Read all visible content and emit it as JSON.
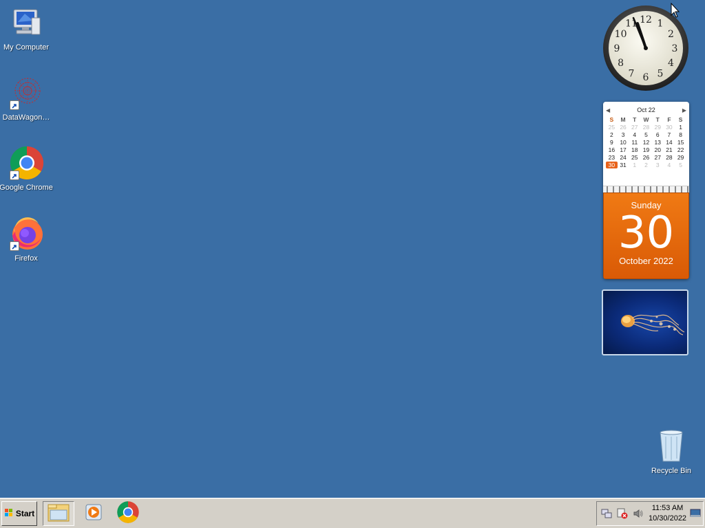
{
  "desktop": {
    "background": "#3a6ea5",
    "icons": [
      {
        "label": "My Computer",
        "icon": "computer-icon"
      },
      {
        "label": "DataWagon…",
        "icon": "datawagon-icon"
      },
      {
        "label": "Google Chrome",
        "icon": "chrome-icon"
      },
      {
        "label": "Firefox",
        "icon": "firefox-icon"
      }
    ],
    "recycle_bin": {
      "label": "Recycle Bin",
      "icon": "recycle-bin-icon"
    }
  },
  "clock_gadget": {
    "numerals": [
      "12",
      "1",
      "2",
      "3",
      "4",
      "5",
      "6",
      "7",
      "8",
      "9",
      "10",
      "11"
    ],
    "time_shown": "11:53"
  },
  "calendar_gadget": {
    "month_label": "Oct 22",
    "weekdays": [
      "S",
      "M",
      "T",
      "W",
      "T",
      "F",
      "S"
    ],
    "weeks": [
      [
        "25",
        "26",
        "27",
        "28",
        "29",
        "30",
        "1"
      ],
      [
        "2",
        "3",
        "4",
        "5",
        "6",
        "7",
        "8"
      ],
      [
        "9",
        "10",
        "11",
        "12",
        "13",
        "14",
        "15"
      ],
      [
        "16",
        "17",
        "18",
        "19",
        "20",
        "21",
        "22"
      ],
      [
        "23",
        "24",
        "25",
        "26",
        "27",
        "28",
        "29"
      ],
      [
        "30",
        "31",
        "1",
        "2",
        "3",
        "4",
        "5"
      ]
    ],
    "day_name": "Sunday",
    "day_number": "30",
    "month_year": "October 2022",
    "accent": "#e8621a"
  },
  "slideshow_gadget": {
    "subject": "jellyfish"
  },
  "taskbar": {
    "start_label": "Start",
    "buttons": [
      {
        "name": "file-explorer",
        "icon": "folder-icon"
      },
      {
        "name": "media-player",
        "icon": "media-player-icon"
      },
      {
        "name": "chrome",
        "icon": "chrome-icon"
      }
    ],
    "tray": {
      "icons": [
        "network-icon",
        "security-alert-icon",
        "volume-icon"
      ],
      "time": "11:53 AM",
      "date": "10/30/2022"
    }
  }
}
